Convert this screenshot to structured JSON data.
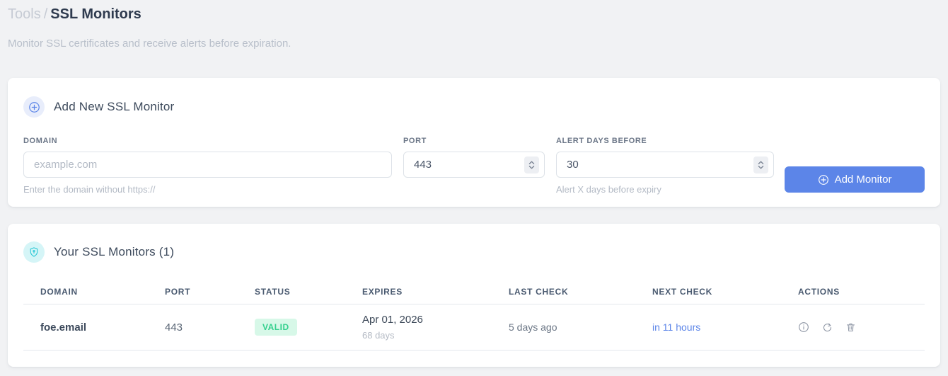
{
  "breadcrumb": {
    "parent": "Tools",
    "separator": "/",
    "current": "SSL Monitors"
  },
  "subtitle": "Monitor SSL certificates and receive alerts before expiration.",
  "add_monitor": {
    "title": "Add New SSL Monitor",
    "fields": {
      "domain": {
        "label": "DOMAIN",
        "placeholder": "example.com",
        "helper": "Enter the domain without https://"
      },
      "port": {
        "label": "PORT",
        "value": "443"
      },
      "alert_days": {
        "label": "ALERT DAYS BEFORE",
        "value": "30",
        "helper": "Alert X days before expiry"
      }
    },
    "submit_label": "Add Monitor"
  },
  "monitors": {
    "title": "Your SSL Monitors (1)",
    "count": "1",
    "columns": [
      "DOMAIN",
      "PORT",
      "STATUS",
      "EXPIRES",
      "LAST CHECK",
      "NEXT CHECK",
      "ACTIONS"
    ],
    "rows": [
      {
        "domain": "foe.email",
        "port": "443",
        "status": "VALID",
        "expires_date": "Apr 01, 2026",
        "expires_days": "68 days",
        "last_check": "5 days ago",
        "next_check": "in 11 hours"
      }
    ],
    "icons": [
      "info-icon",
      "refresh-icon",
      "trash-icon"
    ]
  },
  "colors": {
    "accent_blue": "#5c85e8",
    "accent_cyan": "#2fc9d6",
    "valid_green": "#34d08e",
    "valid_green_bg": "#d7f8e8",
    "page_bg": "#f1f2f4"
  }
}
